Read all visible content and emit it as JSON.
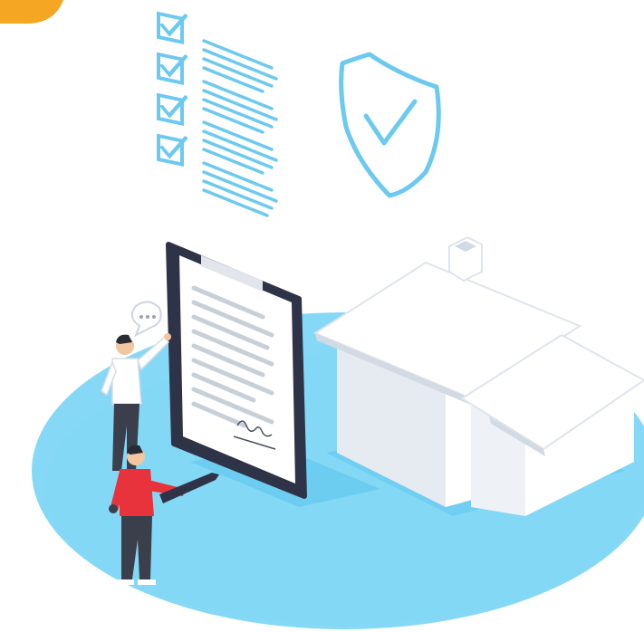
{
  "illustration": {
    "palette": {
      "ground": "#7fd6f5",
      "ground_shadow": "#5ec6ee",
      "line_blue": "#6cc9f0",
      "orange": "#f5a623",
      "board_frame": "#2f3347",
      "paper": "#ffffff",
      "text_lines": "#c9cfd8",
      "house_light": "#ffffff",
      "house_shade": "#e6ebf1",
      "house_dark": "#d3dae3",
      "shirt_red": "#e8323c",
      "shirt_white": "#ffffff",
      "pants": "#3a3f4b",
      "hair": "#2b2b33",
      "skin": "#f2c6a0"
    },
    "icons": [
      "checklist-icon",
      "shield-check-icon",
      "speech-bubble-icon",
      "signature-icon",
      "pen-icon",
      "house-icon",
      "clipboard-icon"
    ]
  }
}
